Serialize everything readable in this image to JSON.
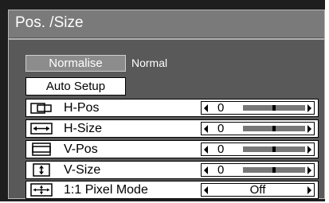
{
  "menu": {
    "title": "Pos. /Size",
    "normalise_label": "Normalise",
    "normal_status": "Normal",
    "auto_setup_label": "Auto Setup"
  },
  "rows": [
    {
      "label": "H-Pos",
      "icon": "h-pos-icon",
      "value": "0",
      "slider_level": 0.5
    },
    {
      "label": "H-Size",
      "icon": "h-size-icon",
      "value": "0",
      "slider_level": 0.5
    },
    {
      "label": "V-Pos",
      "icon": "v-pos-icon",
      "value": "0",
      "slider_level": 0.5
    },
    {
      "label": "V-Size",
      "icon": "v-size-icon",
      "value": "0",
      "slider_level": 0.5
    },
    {
      "label": "1:1 Pixel Mode",
      "icon": "pixel-mode-icon",
      "value": "Off"
    }
  ],
  "colors": {
    "panel": "#595959",
    "title_bar": "#7a7a7a",
    "button_active": "#8c8c8c",
    "row_bg": "#ffffff"
  }
}
